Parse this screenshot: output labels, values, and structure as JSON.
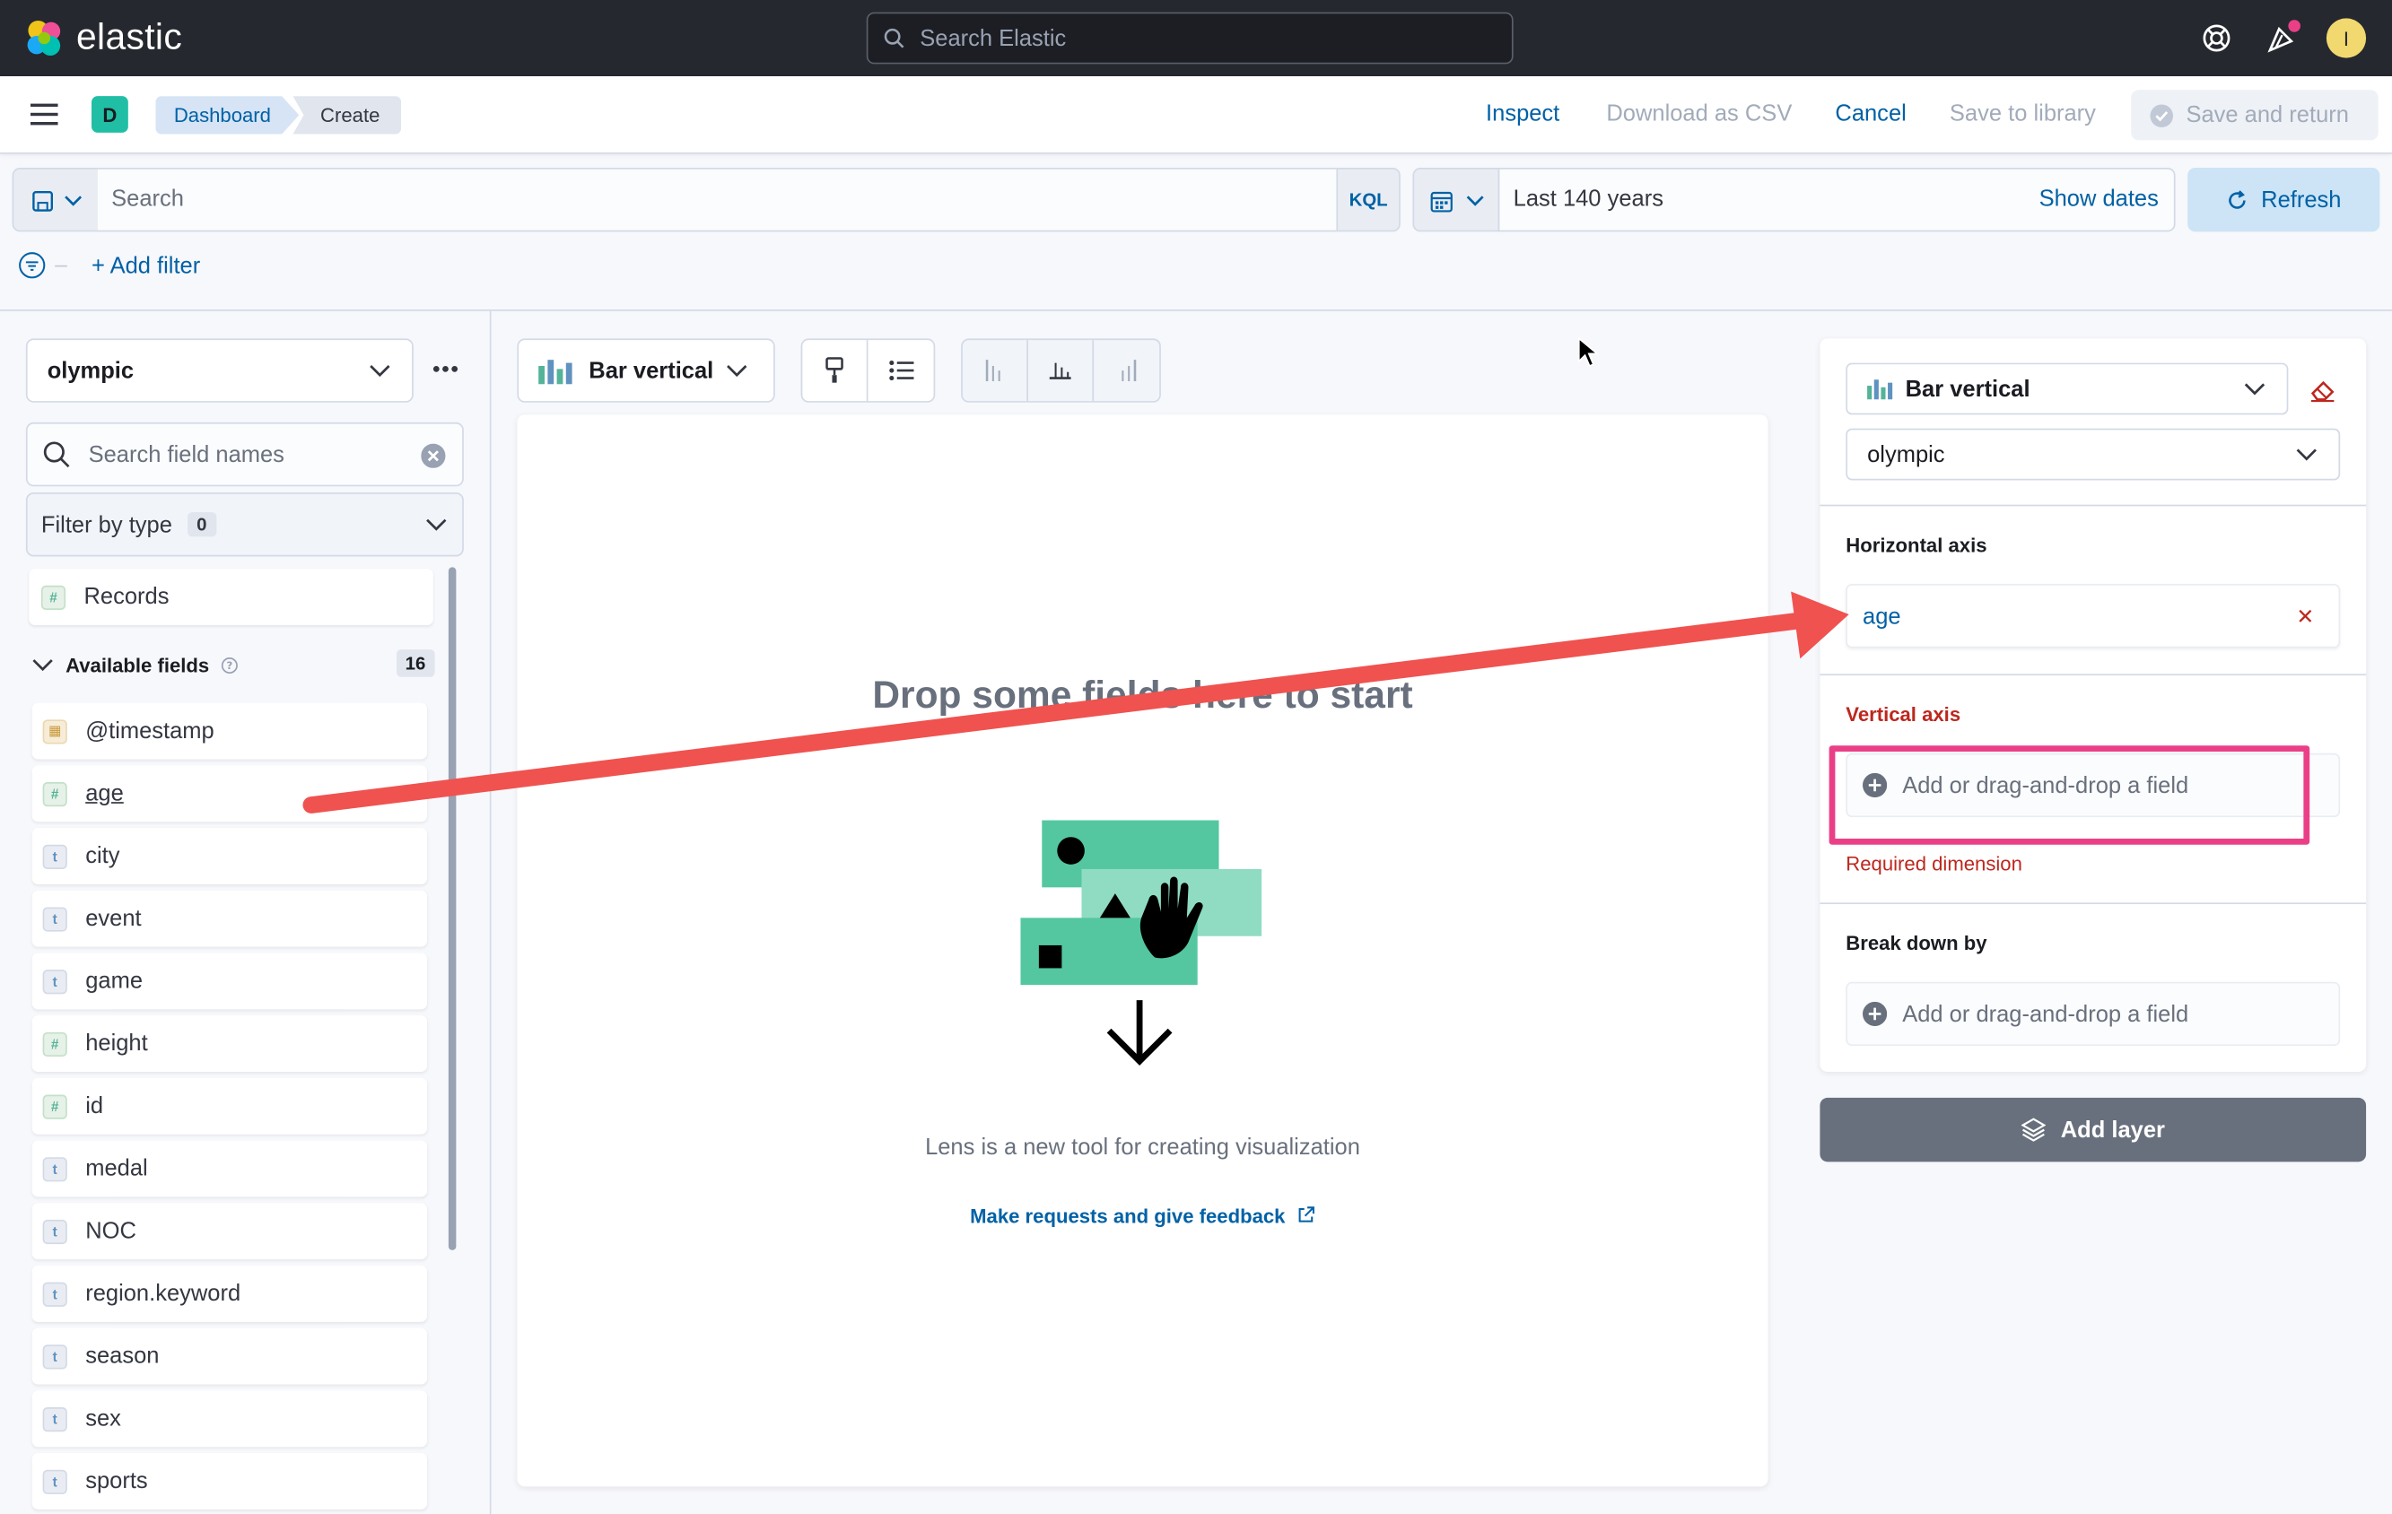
{
  "header": {
    "logo_text": "elastic",
    "search_placeholder": "Search Elastic",
    "avatar_initial": "I",
    "icons": [
      "help-icon",
      "news-icon"
    ],
    "news_dot_color": "#ea3f87"
  },
  "subheader": {
    "space_initial": "D",
    "breadcrumbs": [
      "Dashboard",
      "Create"
    ],
    "actions": {
      "inspect": "Inspect",
      "download_csv": "Download as CSV",
      "cancel": "Cancel",
      "save_library": "Save to library",
      "save_return": "Save and return"
    }
  },
  "query": {
    "search_placeholder": "Search",
    "language": "KQL",
    "time_range": "Last 140 years",
    "show_dates": "Show dates",
    "refresh": "Refresh",
    "add_filter": "+ Add filter"
  },
  "sidebar": {
    "data_view": "olympic",
    "field_search_placeholder": "Search field names",
    "filter_by_type": "Filter by type",
    "filter_count": "0",
    "records": "Records",
    "available_fields_label": "Available fields",
    "available_fields_count": "16",
    "fields": [
      {
        "name": "@timestamp",
        "type": "date"
      },
      {
        "name": "age",
        "type": "number"
      },
      {
        "name": "city",
        "type": "string"
      },
      {
        "name": "event",
        "type": "string"
      },
      {
        "name": "game",
        "type": "string"
      },
      {
        "name": "height",
        "type": "number"
      },
      {
        "name": "id",
        "type": "number"
      },
      {
        "name": "medal",
        "type": "string"
      },
      {
        "name": "NOC",
        "type": "string"
      },
      {
        "name": "region.keyword",
        "type": "string"
      },
      {
        "name": "season",
        "type": "string"
      },
      {
        "name": "sex",
        "type": "string"
      },
      {
        "name": "sports",
        "type": "string"
      }
    ]
  },
  "workspace": {
    "chart_type": "Bar vertical",
    "drop_title": "Drop some fields here to start",
    "lens_text": "Lens is a new tool for creating visualization",
    "feedback_link": "Make requests and give feedback",
    "illustration_color": "#54c7a1"
  },
  "config": {
    "chart_type": "Bar vertical",
    "index": "olympic",
    "horizontal_axis_label": "Horizontal axis",
    "horizontal_axis_value": "age",
    "vertical_axis_label": "Vertical axis",
    "vertical_axis_placeholder": "Add or drag-and-drop a field",
    "required_text": "Required dimension",
    "breakdown_label": "Break down by",
    "breakdown_placeholder": "Add or drag-and-drop a field",
    "add_layer": "Add layer"
  },
  "annotation": {
    "arrow_color": "#f0524f",
    "highlight_color": "#ea3f87"
  }
}
